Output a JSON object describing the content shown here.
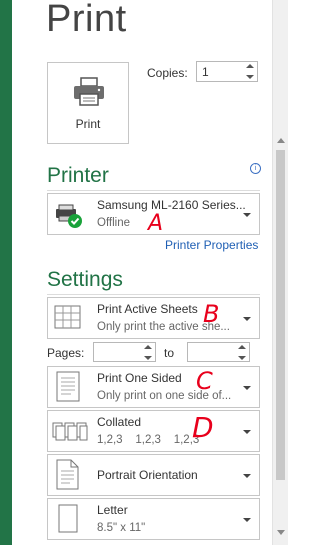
{
  "header": {
    "title": "Print"
  },
  "print_button": {
    "label": "Print"
  },
  "copies": {
    "label": "Copies:",
    "value": "1"
  },
  "printer": {
    "section_title": "Printer",
    "name": "Samsung ML-2160 Series...",
    "status": "Offline",
    "properties_link": "Printer Properties",
    "info_icon": "i"
  },
  "settings": {
    "section_title": "Settings",
    "print_what": {
      "main": "Print Active Sheets",
      "sub": "Only print the active she..."
    },
    "pages": {
      "label": "Pages:",
      "from": "",
      "to_label": "to",
      "to": ""
    },
    "sides": {
      "main": "Print One Sided",
      "sub": "Only print on one side of..."
    },
    "collation": {
      "main": "Collated",
      "sub": "1,2,3    1,2,3    1,2,3"
    },
    "orientation": {
      "main": "Portrait Orientation"
    },
    "paper": {
      "main": "Letter",
      "sub": "8.5\" x 11\""
    }
  },
  "annotations": {
    "a": "A",
    "b": "B",
    "c": "C",
    "d": "D"
  },
  "colors": {
    "accent": "#217346",
    "link": "#1f5fb4",
    "annotation": "#e8001c"
  }
}
